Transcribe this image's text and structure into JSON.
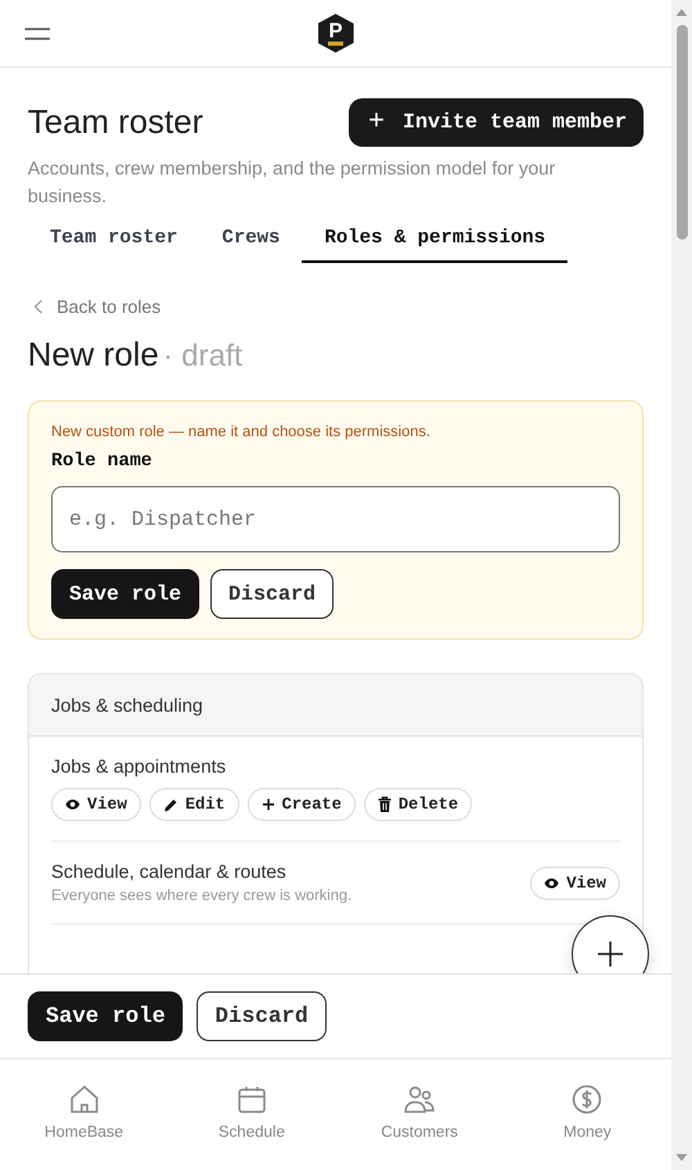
{
  "header": {
    "logo_letter": "P"
  },
  "page": {
    "title": "Team roster",
    "subtitle": "Accounts, crew membership, and the permission model for your business.",
    "action": "Invite team member",
    "action_icon": "+"
  },
  "tabs": [
    {
      "label": "Team roster",
      "selected": false
    },
    {
      "label": "Crews",
      "selected": false
    },
    {
      "label": "Roles & permissions",
      "selected": true
    }
  ],
  "back_link": "Back to roles",
  "role": {
    "title": "New role",
    "status": "· draft"
  },
  "notice": {
    "message": "New custom role — name it and choose its permissions.",
    "field_label": "Role name",
    "placeholder": "e.g. Dispatcher",
    "buttons": [
      {
        "label": "Save role",
        "kind": "primary"
      },
      {
        "label": "Discard",
        "kind": "secondary"
      }
    ]
  },
  "permission_group": {
    "title": "Jobs & scheduling",
    "rows": [
      {
        "name": "Jobs & appointments",
        "chips": [
          {
            "label": "View",
            "kind": "view"
          },
          {
            "label": "Edit",
            "kind": "edit"
          },
          {
            "label": "Create",
            "kind": "create"
          },
          {
            "label": "Delete",
            "kind": "delete"
          }
        ]
      },
      {
        "name": "Schedule, calendar & routes",
        "description": "Everyone sees where every crew is working.",
        "chips": [
          {
            "label": "View",
            "kind": "view"
          }
        ]
      }
    ]
  },
  "save_bar": {
    "buttons": [
      {
        "label": "Save role",
        "kind": "primary"
      },
      {
        "label": "Discard",
        "kind": "secondary"
      }
    ]
  },
  "bottom_nav": [
    {
      "label": "HomeBase",
      "kind": "home"
    },
    {
      "label": "Schedule",
      "kind": "calendar"
    },
    {
      "label": "Customers",
      "kind": "people"
    },
    {
      "label": "Money",
      "kind": "dollar"
    }
  ]
}
